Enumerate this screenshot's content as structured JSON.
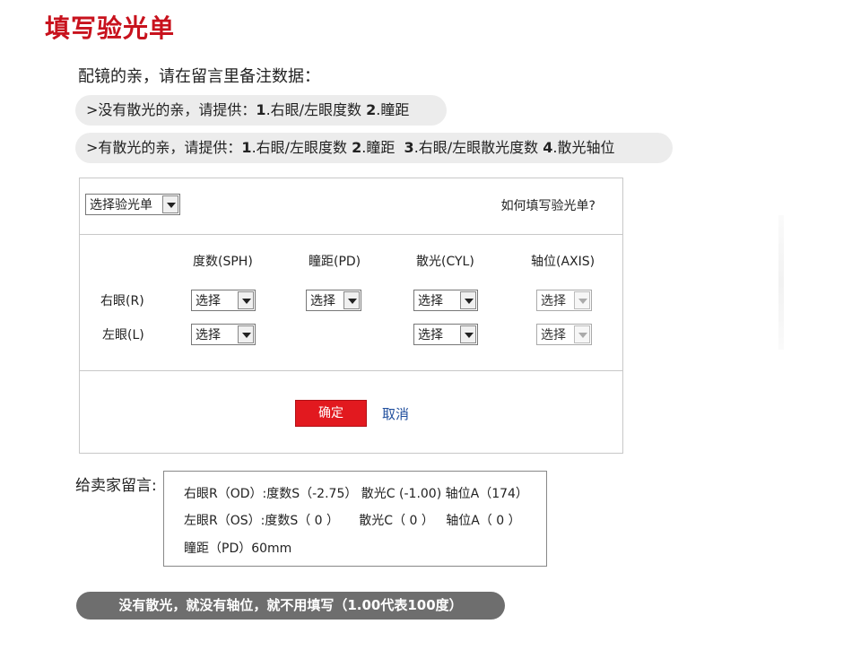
{
  "title": "填写验光单",
  "intro": "配镜的亲，请在留言里备注数据：",
  "tips": {
    "no_astig": {
      "prefix": ">没有散光的亲，请提供：",
      "n1": "1",
      "t1": ".右眼/左眼度数 ",
      "n2": "2",
      "t2": ".瞳距"
    },
    "astig": {
      "prefix": ">有散光的亲，请提供：",
      "n1": "1",
      "t1": ".右眼/左眼度数 ",
      "n2": "2",
      "t2": ".瞳距  ",
      "n3": "3",
      "t3": ".右眼/左眼散光度数 ",
      "n4": "4",
      "t4": ".散光轴位"
    }
  },
  "form": {
    "template_select": "选择验光单",
    "how_link": "如何填写验光单?",
    "columns": [
      "度数(SPH)",
      "瞳距(PD)",
      "散光(CYL)",
      "轴位(AXIS)"
    ],
    "rows": [
      "右眼(R)",
      "左眼(L)"
    ],
    "select_value": "选择",
    "confirm": "确定",
    "cancel": "取消"
  },
  "note": {
    "label": "给卖家留言:",
    "lines": [
      "右眼R（OD）:度数S（-2.75） 散光C (-1.00) 轴位A（174）",
      "左眼R（OS）:度数S（ 0 ）     散光C（ 0 ）   轴位A（ 0 ）",
      "瞳距（PD）60mm"
    ]
  },
  "bottom_note": "没有散光，就没有轴位，就不用填写（1.00代表100度）"
}
